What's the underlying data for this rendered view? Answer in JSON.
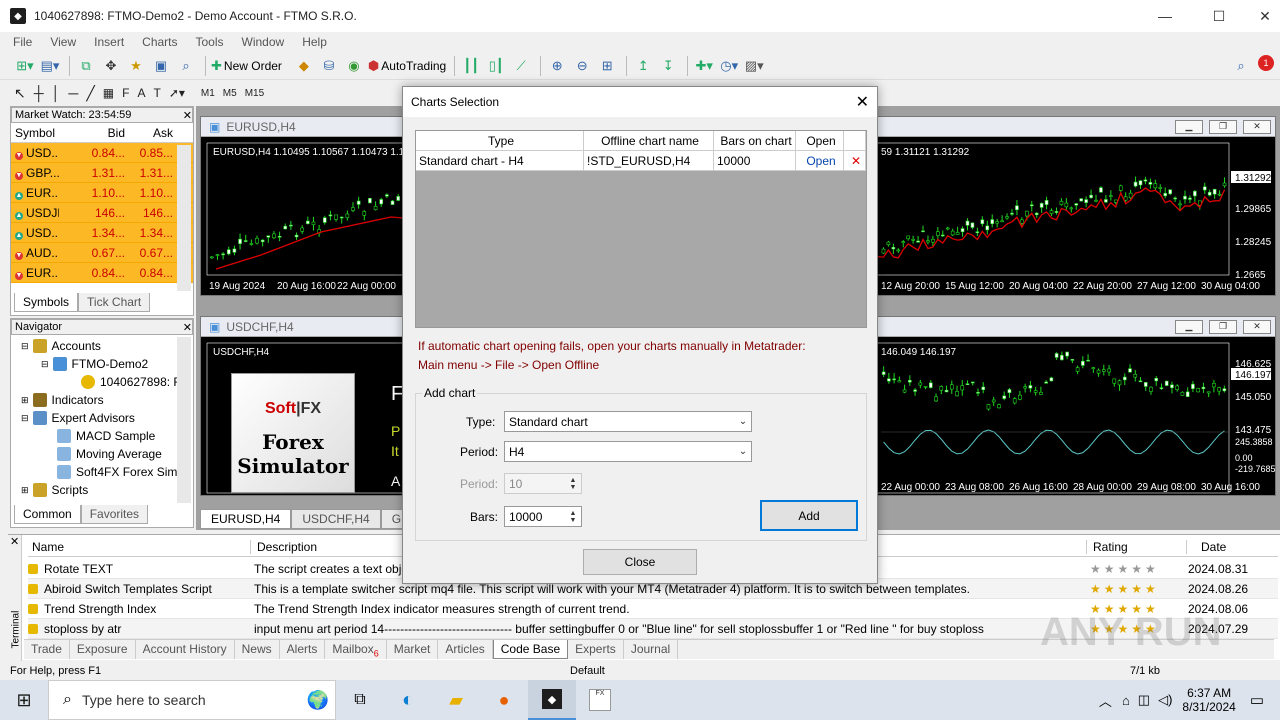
{
  "window": {
    "title": "1040627898: FTMO-Demo2 - Demo Account - FTMO S.R.O."
  },
  "menu": [
    "File",
    "View",
    "Insert",
    "Charts",
    "Tools",
    "Window",
    "Help"
  ],
  "toolbar": {
    "new_order": "New Order",
    "autotrading": "AutoTrading"
  },
  "timeframes": [
    "M1",
    "M5",
    "M15"
  ],
  "market_watch": {
    "title": "Market Watch: 23:54:59",
    "columns": [
      "Symbol",
      "Bid",
      "Ask"
    ],
    "rows": [
      {
        "symbol": "USD...",
        "bid": "0.84...",
        "ask": "0.85...",
        "dir": "down"
      },
      {
        "symbol": "GBP...",
        "bid": "1.31...",
        "ask": "1.31...",
        "dir": "down"
      },
      {
        "symbol": "EUR...",
        "bid": "1.10...",
        "ask": "1.10...",
        "dir": "up"
      },
      {
        "symbol": "USDJPY",
        "bid": "146...",
        "ask": "146...",
        "dir": "up"
      },
      {
        "symbol": "USD...",
        "bid": "1.34...",
        "ask": "1.34...",
        "dir": "up"
      },
      {
        "symbol": "AUD...",
        "bid": "0.67...",
        "ask": "0.67...",
        "dir": "down"
      },
      {
        "symbol": "EUR...",
        "bid": "0.84...",
        "ask": "0.84...",
        "dir": "down"
      }
    ],
    "tabs": [
      "Symbols",
      "Tick Chart"
    ]
  },
  "navigator": {
    "title": "Navigator",
    "items": [
      "Accounts",
      "FTMO-Demo2",
      "1040627898: F",
      "Indicators",
      "Expert Advisors",
      "MACD Sample",
      "Moving Average",
      "Soft4FX Forex Sim",
      "Scripts"
    ],
    "tabs": [
      "Common",
      "Favorites"
    ]
  },
  "charts": {
    "eurusd": {
      "title": "EURUSD,H4",
      "info": "EURUSD,H4  1.10495 1.10567 1.10473 1.104",
      "right_info": "59 1.31121 1.31292",
      "x_left": [
        "19 Aug 2024",
        "20 Aug 16:00",
        "22 Aug 00:00"
      ],
      "x_right": [
        "12 Aug 20:00",
        "15 Aug 12:00",
        "20 Aug 04:00",
        "22 Aug 20:00",
        "27 Aug 12:00",
        "30 Aug 04:00"
      ],
      "y": [
        "1.31292",
        "1.29865",
        "1.28245",
        "1.2665"
      ]
    },
    "usdchf": {
      "title": "USDCHF,H4",
      "info": "USDCHF,H4",
      "right_info": "146.049 146.197",
      "x_right": [
        "22 Aug 00:00",
        "23 Aug 08:00",
        "26 Aug 16:00",
        "28 Aug 00:00",
        "29 Aug 08:00",
        "30 Aug 16:00"
      ],
      "y": [
        "146.625",
        "146.197",
        "145.050",
        "143.475",
        "245.3858",
        "0.00",
        "-219.7685"
      ]
    },
    "banner": {
      "brand": "Soft FX",
      "line1": "Forex",
      "line2": "Simulator",
      "side1": "F",
      "side2": "P",
      "side3": "It",
      "side4": "A"
    },
    "tabs": [
      "EURUSD,H4",
      "USDCHF,H4",
      "GBP"
    ]
  },
  "dialog": {
    "title": "Charts Selection",
    "columns": [
      "Type",
      "Offline chart name",
      "Bars on chart",
      "Open"
    ],
    "row": {
      "type": "Standard chart - H4",
      "name": "!STD_EURUSD,H4",
      "bars": "10000",
      "open": "Open"
    },
    "msg1": "If automatic chart opening fails, open your charts manually in Metatrader:",
    "msg2": "Main menu -> File -> Open Offline",
    "group": "Add chart",
    "type_label": "Type:",
    "type_value": "Standard chart",
    "period_label": "Period:",
    "period_value": "H4",
    "period2_label": "Period:",
    "period2_value": "10",
    "bars_label": "Bars:",
    "bars_value": "10000",
    "add": "Add",
    "close": "Close"
  },
  "terminal": {
    "columns": {
      "name": "Name",
      "desc": "Description",
      "rating": "Rating",
      "date": "Date"
    },
    "rows": [
      {
        "name": "Rotate TEXT",
        "desc": "The script creates a text obje",
        "stars": 0,
        "date": "2024.08.31"
      },
      {
        "name": "Abiroid Switch Templates Script",
        "desc": "This is a template switcher script mq4 file. This script will work with your MT4 (Metatrader 4) platform. It is to switch between templates.",
        "stars": 5,
        "date": "2024.08.26"
      },
      {
        "name": "Trend Strength Index",
        "desc": "The Trend Strength Index indicator measures strength of current trend.",
        "stars": 5,
        "date": "2024.08.06"
      },
      {
        "name": "stoploss by atr",
        "desc": "input menu art period 14-------------------------------- buffer settingbuffer 0 or \"Blue line\" for sell stoplossbuffer 1 or \"Red line \" for buy stoploss",
        "stars": 5,
        "date": "2024.07.29"
      }
    ],
    "tabs": [
      "Trade",
      "Exposure",
      "Account History",
      "News",
      "Alerts",
      "Mailbox",
      "Market",
      "Articles",
      "Code Base",
      "Experts",
      "Journal"
    ],
    "mailbox_badge": "6",
    "side_label": "Terminal"
  },
  "statusbar": {
    "help": "For Help, press F1",
    "default": "Default",
    "traffic": "7/1 kb"
  },
  "taskbar": {
    "search_placeholder": "Type here to search",
    "time": "6:37 AM",
    "date": "8/31/2024"
  },
  "watermark": "ANY RUN"
}
